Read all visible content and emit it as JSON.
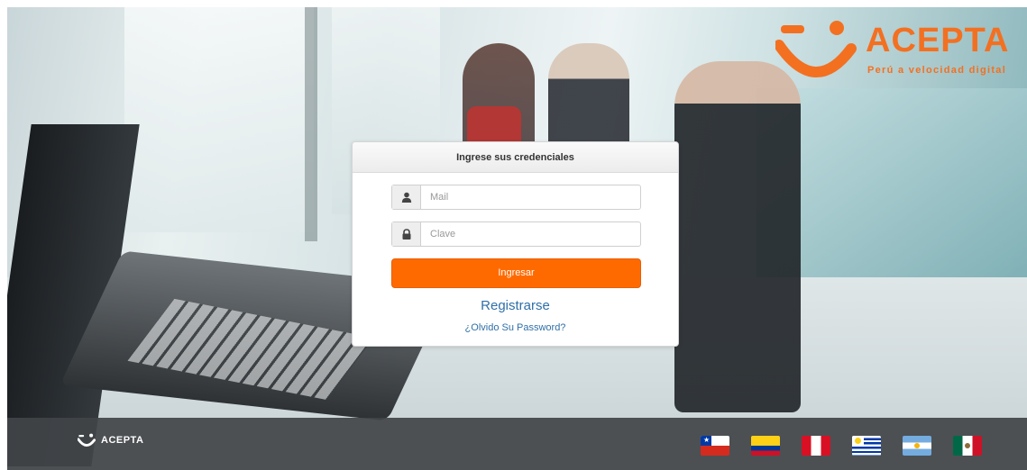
{
  "brand": {
    "name": "ACEPTA",
    "tagline": "Perú a velocidad digital",
    "color": "#f37021"
  },
  "login": {
    "title": "Ingrese sus credenciales",
    "mail_placeholder": "Mail",
    "mail_value": "",
    "password_placeholder": "Clave",
    "password_value": "",
    "submit_label": "Ingresar",
    "register_label": "Registrarse",
    "forgot_label": "¿Olvido Su Password?",
    "button_color": "#ff6a00",
    "link_color": "#2f6fa8"
  },
  "icons": {
    "mail": "user-icon",
    "password": "lock-icon"
  },
  "footer": {
    "logo_text": "ACEPTA",
    "flags": [
      "chile-flag-icon",
      "colombia-flag-icon",
      "peru-flag-icon",
      "uruguay-flag-icon",
      "argentina-flag-icon",
      "mexico-flag-icon"
    ]
  }
}
